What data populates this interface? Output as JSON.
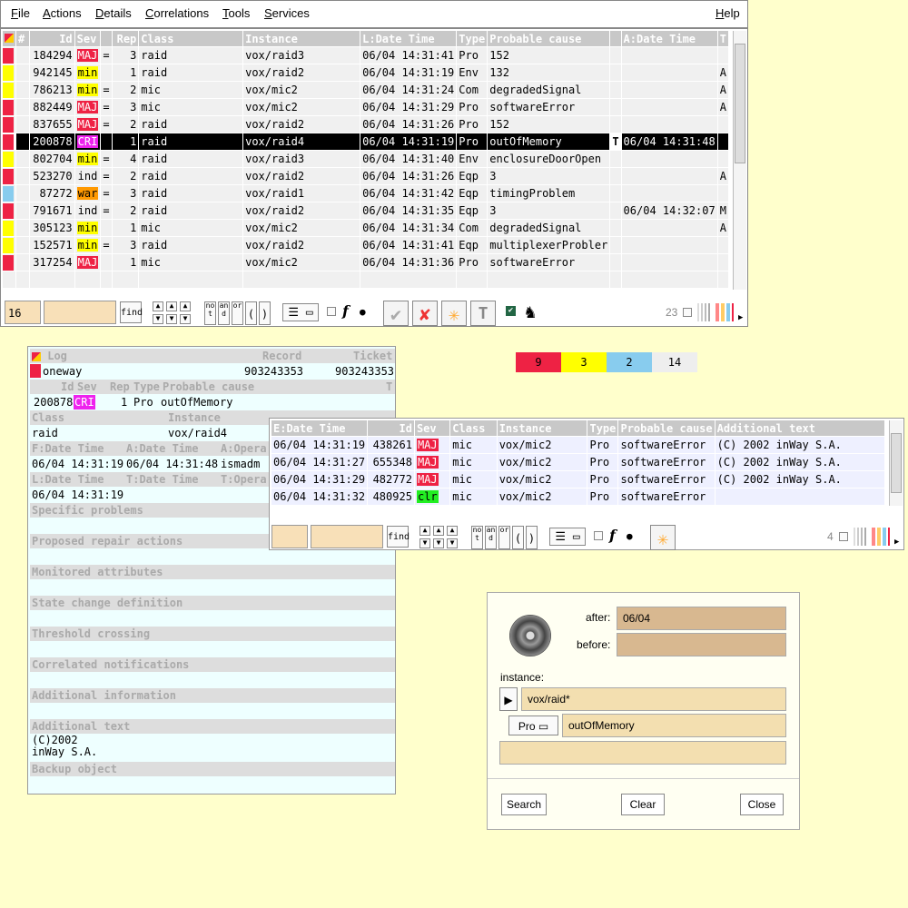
{
  "menu": {
    "file": "File",
    "actions": "Actions",
    "details": "Details",
    "correlations": "Correlations",
    "tools": "Tools",
    "services": "Services",
    "help": "Help"
  },
  "alarm_table": {
    "columns": [
      "#",
      "Id",
      "Sev",
      "Rep",
      "Class",
      "Instance",
      "L:Date Time",
      "Type",
      "Probable cause",
      "A:Date Time",
      "T"
    ],
    "rows": [
      {
        "flag": "#ee2244",
        "id": "184294",
        "sev": "MAJ",
        "eq": "=",
        "rep": "3",
        "class": "raid",
        "instance": "vox/raid3",
        "ldate": "06/04 14:31:41",
        "type": "Pro",
        "cause": "152",
        "t": "",
        "adate": "",
        "a": ""
      },
      {
        "flag": "#ffff00",
        "id": "942145",
        "sev": "min",
        "eq": "",
        "rep": "1",
        "class": "raid",
        "instance": "vox/raid2",
        "ldate": "06/04 14:31:19",
        "type": "Env",
        "cause": "132",
        "t": "",
        "adate": "",
        "a": "A"
      },
      {
        "flag": "#ffff00",
        "id": "786213",
        "sev": "min",
        "eq": "=",
        "rep": "2",
        "class": "mic",
        "instance": "vox/mic2",
        "ldate": "06/04 14:31:24",
        "type": "Com",
        "cause": "degradedSignal",
        "t": "",
        "adate": "",
        "a": "A"
      },
      {
        "flag": "#ee2244",
        "id": "882449",
        "sev": "MAJ",
        "eq": "=",
        "rep": "3",
        "class": "mic",
        "instance": "vox/mic2",
        "ldate": "06/04 14:31:29",
        "type": "Pro",
        "cause": "softwareError",
        "t": "",
        "adate": "",
        "a": "A"
      },
      {
        "flag": "#ee2244",
        "id": "837655",
        "sev": "MAJ",
        "eq": "=",
        "rep": "2",
        "class": "raid",
        "instance": "vox/raid2",
        "ldate": "06/04 14:31:26",
        "type": "Pro",
        "cause": "152",
        "t": "",
        "adate": "",
        "a": ""
      },
      {
        "flag": "#ee2244",
        "id": "200878",
        "sev": "CRI",
        "eq": "",
        "rep": "1",
        "class": "raid",
        "instance": "vox/raid4",
        "ldate": "06/04 14:31:19",
        "type": "Pro",
        "cause": "outOfMemory",
        "t": "T",
        "adate": "06/04 14:31:48",
        "a": "",
        "selected": true
      },
      {
        "flag": "#ffff00",
        "id": "802704",
        "sev": "min",
        "eq": "=",
        "rep": "4",
        "class": "raid",
        "instance": "vox/raid3",
        "ldate": "06/04 14:31:40",
        "type": "Env",
        "cause": "enclosureDoorOpen",
        "t": "",
        "adate": "",
        "a": ""
      },
      {
        "flag": "#ee2244",
        "id": "523270",
        "sev": "ind",
        "eq": "=",
        "rep": "2",
        "class": "raid",
        "instance": "vox/raid2",
        "ldate": "06/04 14:31:26",
        "type": "Eqp",
        "cause": "3",
        "t": "",
        "adate": "",
        "a": "A"
      },
      {
        "flag": "#88ccee",
        "id": "87272",
        "sev": "war",
        "eq": "=",
        "rep": "3",
        "class": "raid",
        "instance": "vox/raid1",
        "ldate": "06/04 14:31:42",
        "type": "Eqp",
        "cause": "timingProblem",
        "t": "",
        "adate": "",
        "a": ""
      },
      {
        "flag": "#ee2244",
        "id": "791671",
        "sev": "ind",
        "eq": "=",
        "rep": "2",
        "class": "raid",
        "instance": "vox/raid2",
        "ldate": "06/04 14:31:35",
        "type": "Eqp",
        "cause": "3",
        "t": "",
        "adate": "06/04 14:32:07",
        "a": "M"
      },
      {
        "flag": "#ffff00",
        "id": "305123",
        "sev": "min",
        "eq": "",
        "rep": "1",
        "class": "mic",
        "instance": "vox/mic2",
        "ldate": "06/04 14:31:34",
        "type": "Com",
        "cause": "degradedSignal",
        "t": "",
        "adate": "",
        "a": "A"
      },
      {
        "flag": "#ffff00",
        "id": "152571",
        "sev": "min",
        "eq": "=",
        "rep": "3",
        "class": "raid",
        "instance": "vox/raid2",
        "ldate": "06/04 14:31:41",
        "type": "Eqp",
        "cause": "multiplexerProbler",
        "t": "",
        "adate": "",
        "a": ""
      },
      {
        "flag": "#ee2244",
        "id": "317254",
        "sev": "MAJ",
        "eq": "",
        "rep": "1",
        "class": "mic",
        "instance": "vox/mic2",
        "ldate": "06/04 14:31:36",
        "type": "Pro",
        "cause": "softwareError",
        "t": "",
        "adate": "",
        "a": ""
      }
    ]
  },
  "main_toolbar": {
    "count_field": "16",
    "find": "find",
    "not": "not",
    "and": "and",
    "or": "or",
    "lparen": "(",
    "rparen": ")",
    "f": "f",
    "T": "T",
    "total": "23"
  },
  "counters": [
    {
      "value": "9",
      "color": "#ee2244"
    },
    {
      "value": "3",
      "color": "#ffff00"
    },
    {
      "value": "2",
      "color": "#88ccee"
    },
    {
      "value": "14",
      "color": "#eeeeee"
    }
  ],
  "detail": {
    "h_log": "Log",
    "h_record": "Record",
    "h_ticket": "Ticket",
    "log": "oneway",
    "record": "903243353",
    "ticket": "903243353",
    "h_id": "Id",
    "h_sev": "Sev",
    "h_rep": "Rep",
    "h_type": "Type",
    "h_cause": "Probable cause",
    "h_t": "T",
    "id": "200878",
    "sev": "CRI",
    "rep": "1",
    "type": "Pro",
    "cause": "outOfMemory",
    "h_class": "Class",
    "h_instance": "Instance",
    "class": "raid",
    "instance": "vox/raid4",
    "h_fdate": "F:Date Time",
    "h_adate": "A:Date Time",
    "h_aoper": "A:Opera",
    "fdate": "06/04 14:31:19",
    "adate": "06/04 14:31:48",
    "aoper": "ismadm",
    "h_ldate": "L:Date Time",
    "h_tdate": "T:Date Time",
    "h_toper": "T:Opera",
    "ldate": "06/04 14:31:19",
    "sections": [
      "Specific problems",
      "Proposed repair actions",
      "Monitored attributes",
      "State change definition",
      "Threshold crossing",
      "Correlated notifications",
      "Additional information",
      "Additional text"
    ],
    "addtext1": "(C)2002",
    "addtext2": "inWay S.A.",
    "backup": "Backup object"
  },
  "sub_table": {
    "columns": [
      "E:Date Time",
      "Id",
      "Sev",
      "Class",
      "Instance",
      "Type",
      "Probable cause",
      "Additional text"
    ],
    "rows": [
      {
        "edate": "06/04 14:31:19",
        "id": "438261",
        "sev": "MAJ",
        "class": "mic",
        "instance": "vox/mic2",
        "type": "Pro",
        "cause": "softwareError",
        "text": "(C) 2002 inWay S.A."
      },
      {
        "edate": "06/04 14:31:27",
        "id": "655348",
        "sev": "MAJ",
        "class": "mic",
        "instance": "vox/mic2",
        "type": "Pro",
        "cause": "softwareError",
        "text": "(C) 2002 inWay S.A."
      },
      {
        "edate": "06/04 14:31:29",
        "id": "482772",
        "sev": "MAJ",
        "class": "mic",
        "instance": "vox/mic2",
        "type": "Pro",
        "cause": "softwareError",
        "text": "(C) 2002 inWay S.A."
      },
      {
        "edate": "06/04 14:31:32",
        "id": "480925",
        "sev": "clr",
        "class": "mic",
        "instance": "vox/mic2",
        "type": "Pro",
        "cause": "softwareError",
        "text": ""
      }
    ],
    "toolbar": {
      "find": "find",
      "not": "not",
      "and": "and",
      "or": "or",
      "lparen": "(",
      "rparen": ")",
      "f": "f",
      "total": "4"
    }
  },
  "search": {
    "after_label": "after:",
    "before_label": "before:",
    "after_value": "06/04",
    "before_value": "",
    "instance_label": "instance:",
    "instance_value": "vox/raid*",
    "type_value": "Pro",
    "cause_value": "outOfMemory",
    "extra_value": "",
    "search_btn": "Search",
    "clear_btn": "Clear",
    "close_btn": "Close"
  }
}
